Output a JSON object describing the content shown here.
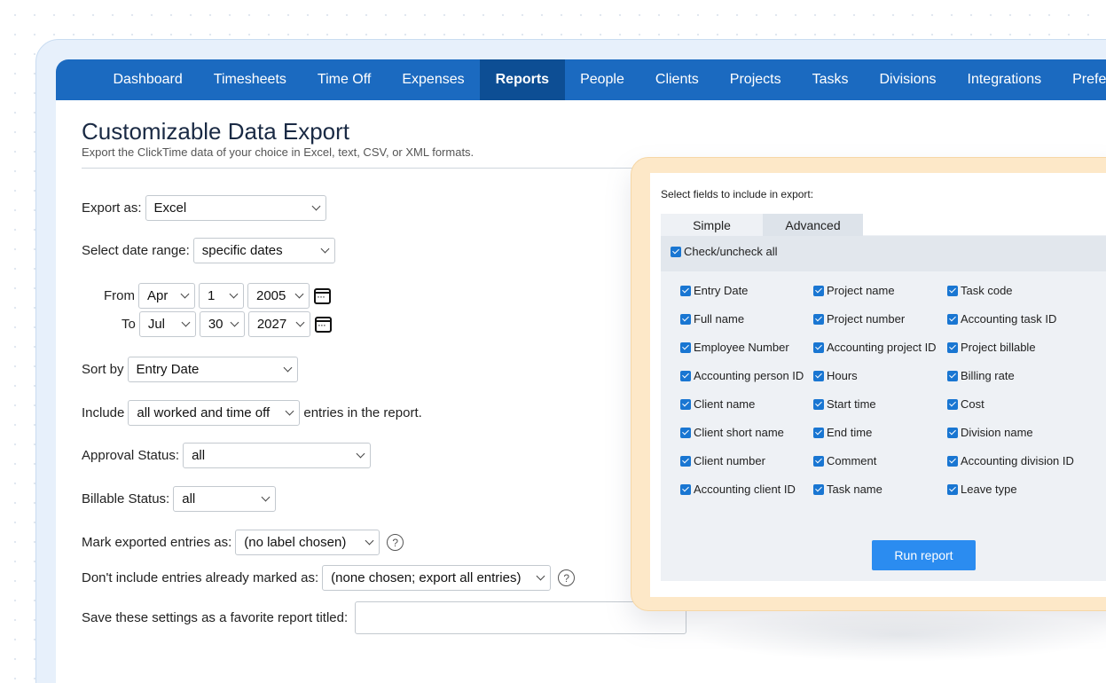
{
  "nav": {
    "items": [
      "Dashboard",
      "Timesheets",
      "Time Off",
      "Expenses",
      "Reports",
      "People",
      "Clients",
      "Projects",
      "Tasks",
      "Divisions",
      "Integrations",
      "Prefe"
    ],
    "active": "Reports"
  },
  "header": {
    "title": "Customizable Data Export",
    "subtitle": "Export the ClickTime data of your choice in Excel, text, CSV, or XML formats."
  },
  "form": {
    "export_as_label": "Export as:",
    "export_as_value": "Excel",
    "date_range_label": "Select date range:",
    "date_range_value": "specific dates",
    "from_label": "From",
    "from_month": "Apr",
    "from_day": "1",
    "from_year": "2005",
    "to_label": "To",
    "to_month": "Jul",
    "to_day": "30",
    "to_year": "2027",
    "sort_label": "Sort by",
    "sort_value": "Entry Date",
    "include_label": "Include",
    "include_value": "all worked and time off",
    "include_suffix": "entries in the report.",
    "approval_label": "Approval Status:",
    "approval_value": "all",
    "billable_label": "Billable Status:",
    "billable_value": "all",
    "mark_label": "Mark exported entries as:",
    "mark_value": "(no label chosen)",
    "dont_include_label": "Don't include entries already marked as:",
    "dont_include_value": "(none chosen; export all entries)",
    "save_label": "Save these settings as a favorite report titled:",
    "save_value": "",
    "help_glyph": "?"
  },
  "panel": {
    "title": "Select fields to include in export:",
    "tabs": [
      "Simple",
      "Advanced"
    ],
    "check_all_label": "Check/uncheck all",
    "columns": [
      [
        "Entry Date",
        "Full name",
        "Employee Number",
        "Accounting person ID",
        "Client name",
        "Client short name",
        "Client number",
        "Accounting client ID"
      ],
      [
        "Project name",
        "Project number",
        "Accounting project ID",
        "Hours",
        "Start time",
        "End time",
        "Comment",
        "Task name"
      ],
      [
        "Task code",
        "Accounting task ID",
        "Project billable",
        "Billing rate",
        "Cost",
        "Division name",
        "Accounting division ID",
        "Leave type"
      ]
    ],
    "run_button": "Run report"
  },
  "colors": {
    "nav_bg": "#1b6ac0",
    "nav_active": "#0d4e94",
    "checkbox": "#1976d2",
    "run_button": "#2b8cf0",
    "panel_frame": "#fde8c8"
  }
}
